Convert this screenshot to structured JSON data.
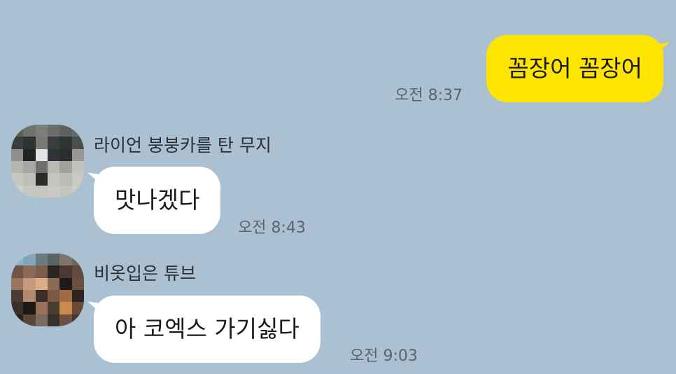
{
  "messages": [
    {
      "direction": "outgoing",
      "text": "꼼장어 꼼장어",
      "time": "오전 8:37"
    },
    {
      "direction": "incoming",
      "sender": "라이언 붕붕카를 탄 무지",
      "text": "맛나겠다",
      "time": "오전 8:43"
    },
    {
      "direction": "incoming",
      "sender": "비옷입은 튜브",
      "text": "아 코엑스 가기싫다",
      "time": "오전 9:03"
    }
  ],
  "colors": {
    "background": "#abc1d1",
    "my_bubble": "#fee500",
    "their_bubble": "#ffffff"
  }
}
